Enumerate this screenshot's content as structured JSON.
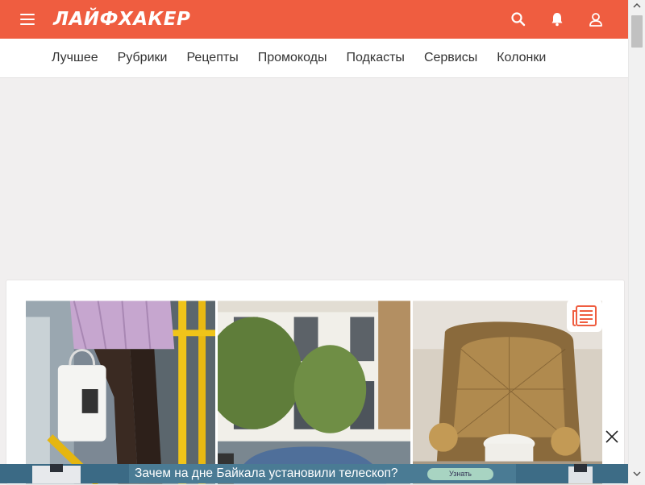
{
  "header": {
    "logo_text": "ЛАЙФХАКЕР",
    "brand_color": "#ef5d40",
    "icons": [
      "menu-icon",
      "search-icon",
      "bell-icon",
      "user-icon"
    ]
  },
  "nav": {
    "items": [
      "Лучшее",
      "Рубрики",
      "Рецепты",
      "Промокоды",
      "Подкасты",
      "Сервисы",
      "Колонки"
    ]
  },
  "card": {
    "badge_icon": "newspaper-icon",
    "images": [
      "photo-bus-passenger",
      "photo-white-townhouses",
      "photo-mosaic-armchair"
    ]
  },
  "ad_banner": {
    "text": "Зачем на дне Байкала установили телескоп?",
    "button_label": "Узнать",
    "close_icon": "close-icon"
  }
}
